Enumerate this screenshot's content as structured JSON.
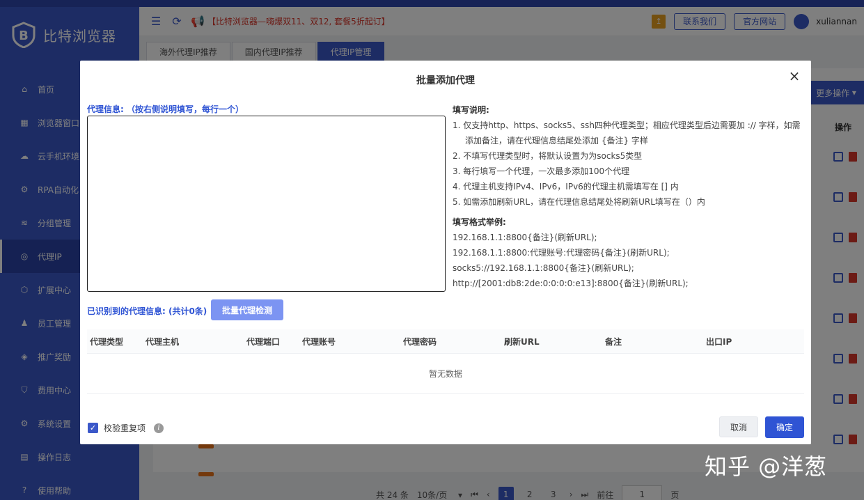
{
  "sidebar": {
    "brand": "比特浏览器",
    "items": [
      {
        "label": "首页",
        "icon": "home-icon"
      },
      {
        "label": "浏览器窗口",
        "icon": "grid-icon"
      },
      {
        "label": "云手机环境",
        "icon": "cloud-icon"
      },
      {
        "label": "RPA自动化",
        "icon": "robot-icon"
      },
      {
        "label": "分组管理",
        "icon": "layers-icon"
      },
      {
        "label": "代理IP",
        "icon": "location-icon",
        "active": true
      },
      {
        "label": "扩展中心",
        "icon": "cube-icon"
      },
      {
        "label": "员工管理",
        "icon": "users-icon"
      },
      {
        "label": "推广奖励",
        "icon": "reward-icon"
      },
      {
        "label": "费用中心",
        "icon": "shield-icon"
      },
      {
        "label": "系统设置",
        "icon": "gear-icon"
      },
      {
        "label": "操作日志",
        "icon": "log-icon"
      },
      {
        "label": "使用帮助",
        "icon": "help-icon"
      }
    ]
  },
  "header": {
    "promo": "【比特浏览器—嗨爆双11、双12, 套餐5折起订】",
    "contact": "联系我们",
    "website": "官方网站",
    "user": "xuliannan",
    "up_badge": "↥"
  },
  "tabs": [
    "海外代理IP推荐",
    "国内代理IP推荐",
    "代理IP管理"
  ],
  "background_page": {
    "more_ops": "更多操作",
    "ops_col": "操作",
    "pager": {
      "total": "共 24 条",
      "page_size": "10条/页",
      "pages": [
        "1",
        "2",
        "3"
      ],
      "goto_label": "前往",
      "goto_value": "1",
      "page_unit": "页"
    }
  },
  "modal": {
    "title": "批量添加代理",
    "close": "×",
    "info_label": "代理信息: （按右侧说明填写，每行一个）",
    "help_title": "填写说明:",
    "help_items": [
      "1. 仅支持http、https、socks5、ssh四种代理类型；相应代理类型后边需要加 :// 字样，如需添加备注，请在代理信息结尾处添加 {备注} 字样",
      "2. 不填写代理类型时，将默认设置为为socks5类型",
      "3. 每行填写一个代理，一次最多添加100个代理",
      "4. 代理主机支持IPv4、IPv6，IPv6的代理主机需填写在 [] 内",
      "5. 如需添加刷新URL，请在代理信息结尾处将刷新URL填写在（）内"
    ],
    "example_title": "填写格式举例:",
    "examples": [
      "192.168.1.1:8800{备注}(刷新URL);",
      "192.168.1.1:8800:代理账号:代理密码{备注}(刷新URL);",
      "socks5://192.168.1.1:8800{备注}(刷新URL);",
      "http://[2001:db8:2de:0:0:0:0:e13]:8800{备注}(刷新URL);"
    ],
    "recognized_label": "已识别到的代理信息: (共计0条)",
    "check_button": "批量代理检测",
    "columns": [
      "代理类型",
      "代理主机",
      "代理端口",
      "代理账号",
      "代理密码",
      "刷新URL",
      "备注",
      "出口IP"
    ],
    "empty_text": "暂无数据",
    "dedupe_label": "校验重复项",
    "cancel": "取消",
    "confirm": "确定"
  },
  "watermark": "知乎 @洋葱"
}
